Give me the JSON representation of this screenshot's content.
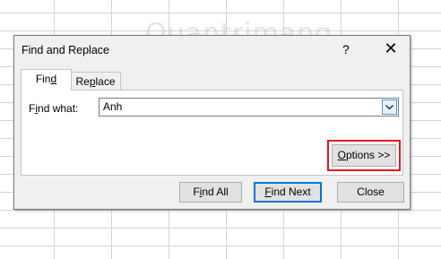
{
  "dialog": {
    "title": "Find and Replace",
    "help_label": "?",
    "close_label": "✕"
  },
  "tabs": [
    {
      "label": "Find",
      "underline_index": 3,
      "active": true
    },
    {
      "label": "Replace",
      "underline_index": 2,
      "active": false
    }
  ],
  "find_what": {
    "label": "Find what:",
    "value": "Anh"
  },
  "buttons": {
    "options": "Options >>",
    "find_all": "Find All",
    "find_next": "Find Next",
    "close": "Close"
  },
  "watermark": "Quantrimang",
  "colors": {
    "highlight": "#e8141f",
    "focus_border": "#0078d7"
  }
}
